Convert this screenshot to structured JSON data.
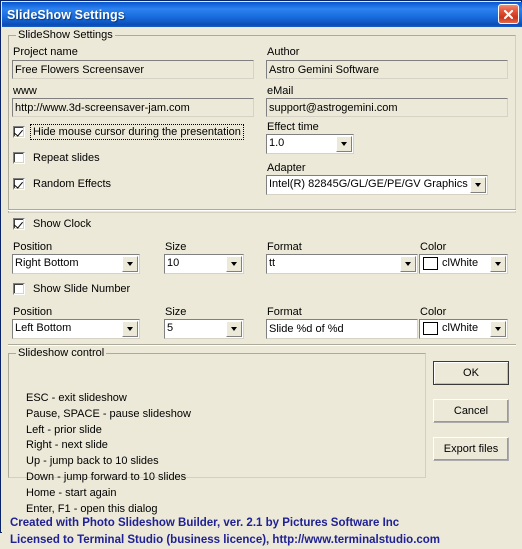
{
  "window": {
    "title": "SlideShow Settings",
    "close_icon": "close-icon",
    "titlebar_color": "#1a6fe0",
    "face_color": "#ece9d8"
  },
  "settings_group": {
    "title": "SlideShow Settings",
    "project_name": {
      "label": "Project name",
      "value": "Free Flowers Screensaver"
    },
    "www": {
      "label": "www",
      "value": "http://www.3d-screensaver-jam.com"
    },
    "author": {
      "label": "Author",
      "value": "Astro Gemini Software"
    },
    "email": {
      "label": "eMail",
      "value": "support@astrogemini.com"
    },
    "effect_time": {
      "label": "Effect time",
      "value": "1.0"
    },
    "adapter": {
      "label": "Adapter",
      "value": "Intel(R) 82845G/GL/GE/PE/GV Graphics"
    },
    "checkboxes": [
      {
        "label": "Hide mouse cursor during the presentation",
        "checked": true,
        "focused": true
      },
      {
        "label": "Repeat slides",
        "checked": false,
        "focused": false
      },
      {
        "label": "Random Effects",
        "checked": true,
        "focused": false
      }
    ]
  },
  "clock_section": {
    "enabled_label": "Show Clock",
    "enabled": true,
    "position": {
      "label": "Position",
      "value": "Right Bottom"
    },
    "size": {
      "label": "Size",
      "value": "10"
    },
    "format": {
      "label": "Format",
      "value": "tt"
    },
    "color": {
      "label": "Color",
      "value": "clWhite",
      "swatch": "#ffffff"
    }
  },
  "slide_number_section": {
    "enabled_label": "Show Slide Number",
    "enabled": false,
    "position": {
      "label": "Position",
      "value": "Left Bottom"
    },
    "size": {
      "label": "Size",
      "value": "5"
    },
    "format": {
      "label": "Format",
      "value": "Slide %d of %d"
    },
    "color": {
      "label": "Color",
      "value": "clWhite",
      "swatch": "#ffffff"
    }
  },
  "slideshow_control": {
    "title": "Slideshow control",
    "lines": [
      "ESC - exit slideshow",
      "Pause, SPACE - pause slideshow",
      "Left - prior slide",
      "Right - next slide",
      "Up - jump back to 10 slides",
      "Down - jump forward to 10 slides",
      "Home - start again",
      "Enter, F1 - open this dialog"
    ]
  },
  "buttons": {
    "ok": "OK",
    "cancel": "Cancel",
    "export": "Export files"
  },
  "footer": {
    "line1": "Created with Photo Slideshow Builder, ver. 2.1   by Pictures Software Inc",
    "line2": "Licensed to Terminal Studio (business licence), http://www.terminalstudio.com",
    "color": "#1f2195"
  }
}
